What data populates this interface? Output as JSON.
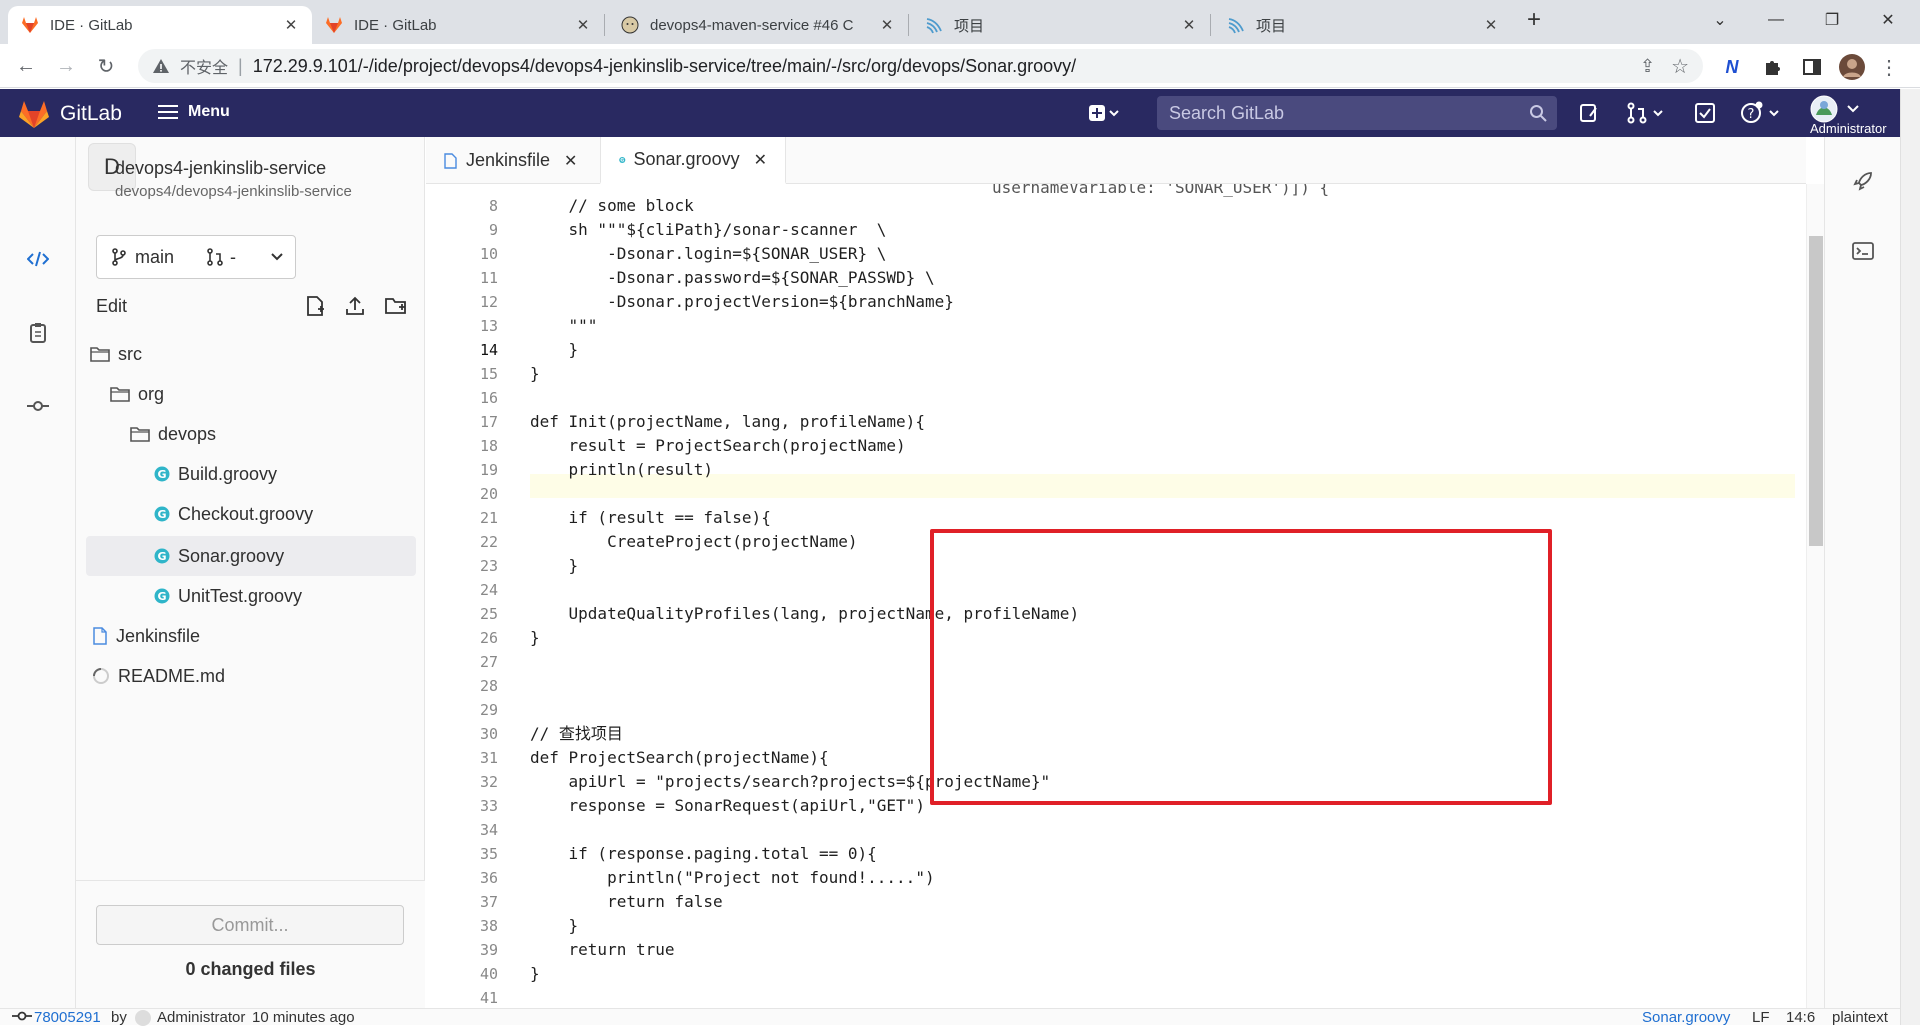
{
  "browser": {
    "tabs": [
      {
        "title": "IDE · GitLab",
        "active": true
      },
      {
        "title": "IDE · GitLab",
        "active": false
      },
      {
        "title": "devops4-maven-service #46 C",
        "active": false
      },
      {
        "title": "项目",
        "active": false
      },
      {
        "title": "项目",
        "active": false
      }
    ],
    "security_label": "不安全",
    "url": "172.29.9.101/-/ide/project/devops4/devops4-jenkinslib-service/tree/main/-/src/org/devops/Sonar.groovy/"
  },
  "header": {
    "brand": "GitLab",
    "menu_label": "Menu",
    "search_placeholder": "Search GitLab",
    "user_label": "Administrator"
  },
  "project": {
    "avatar_letter": "D",
    "name": "devops4-jenkinslib-service",
    "path": "devops4/devops4-jenkinslib-service",
    "branch": "main",
    "mr_label": "-"
  },
  "tree": {
    "edit_label": "Edit",
    "items": [
      {
        "name": "src",
        "type": "folder",
        "depth": 0
      },
      {
        "name": "org",
        "type": "folder",
        "depth": 1
      },
      {
        "name": "devops",
        "type": "folder",
        "depth": 2
      },
      {
        "name": "Build.groovy",
        "type": "groovy",
        "depth": 3
      },
      {
        "name": "Checkout.groovy",
        "type": "groovy",
        "depth": 3
      },
      {
        "name": "Sonar.groovy",
        "type": "groovy",
        "depth": 3,
        "active": true
      },
      {
        "name": "UnitTest.groovy",
        "type": "groovy",
        "depth": 3
      },
      {
        "name": "Jenkinsfile",
        "type": "file",
        "depth": 0
      },
      {
        "name": "README.md",
        "type": "markdown",
        "depth": 0
      }
    ]
  },
  "editor": {
    "tabs": [
      {
        "name": "Jenkinsfile",
        "active": false
      },
      {
        "name": "Sonar.groovy",
        "active": true
      }
    ],
    "current_line": 14,
    "lines": [
      {
        "n": "8",
        "text": "    // some block"
      },
      {
        "n": "9",
        "text": "    sh \"\"\"${cliPath}/sonar-scanner  \\"
      },
      {
        "n": "10",
        "text": "        -Dsonar.login=${SONAR_USER} \\"
      },
      {
        "n": "11",
        "text": "        -Dsonar.password=${SONAR_PASSWD} \\"
      },
      {
        "n": "12",
        "text": "        -Dsonar.projectVersion=${branchName}"
      },
      {
        "n": "13",
        "text": "    \"\"\""
      },
      {
        "n": "14",
        "text": "    }"
      },
      {
        "n": "15",
        "text": "}"
      },
      {
        "n": "16",
        "text": ""
      },
      {
        "n": "17",
        "text": "def Init(projectName, lang, profileName){"
      },
      {
        "n": "18",
        "text": "    result = ProjectSearch(projectName)"
      },
      {
        "n": "19",
        "text": "    println(result)"
      },
      {
        "n": "20",
        "text": ""
      },
      {
        "n": "21",
        "text": "    if (result == false){"
      },
      {
        "n": "22",
        "text": "        CreateProject(projectName)"
      },
      {
        "n": "23",
        "text": "    }"
      },
      {
        "n": "24",
        "text": ""
      },
      {
        "n": "25",
        "text": "    UpdateQualityProfiles(lang, projectName, profileName)"
      },
      {
        "n": "26",
        "text": "}"
      },
      {
        "n": "27",
        "text": ""
      },
      {
        "n": "28",
        "text": ""
      },
      {
        "n": "29",
        "text": ""
      },
      {
        "n": "30",
        "text": "// 查找项目"
      },
      {
        "n": "31",
        "text": "def ProjectSearch(projectName){"
      },
      {
        "n": "32",
        "text": "    apiUrl = \"projects/search?projects=${projectName}\""
      },
      {
        "n": "33",
        "text": "    response = SonarRequest(apiUrl,\"GET\")"
      },
      {
        "n": "34",
        "text": ""
      },
      {
        "n": "35",
        "text": "    if (response.paging.total == 0){"
      },
      {
        "n": "36",
        "text": "        println(\"Project not found!.....\")"
      },
      {
        "n": "37",
        "text": "        return false"
      },
      {
        "n": "38",
        "text": "    }"
      },
      {
        "n": "39",
        "text": "    return true"
      },
      {
        "n": "40",
        "text": "}"
      },
      {
        "n": "41",
        "text": ""
      }
    ],
    "partial_top_text": "usernameVariable: 'SONAR_USER')]) {"
  },
  "commit": {
    "button_label": "Commit...",
    "changed_files": "0 changed files"
  },
  "status": {
    "commit_sha": "78005291",
    "by_label": "by",
    "author": "Administrator",
    "time": "10 minutes ago",
    "file": "Sonar.groovy",
    "eol": "LF",
    "position": "14:6",
    "language": "plaintext"
  },
  "colors": {
    "header_bg": "#292961",
    "highlight_border": "#e02027",
    "groovy_icon": "#2fb5c9",
    "link": "#1f6fd1"
  }
}
